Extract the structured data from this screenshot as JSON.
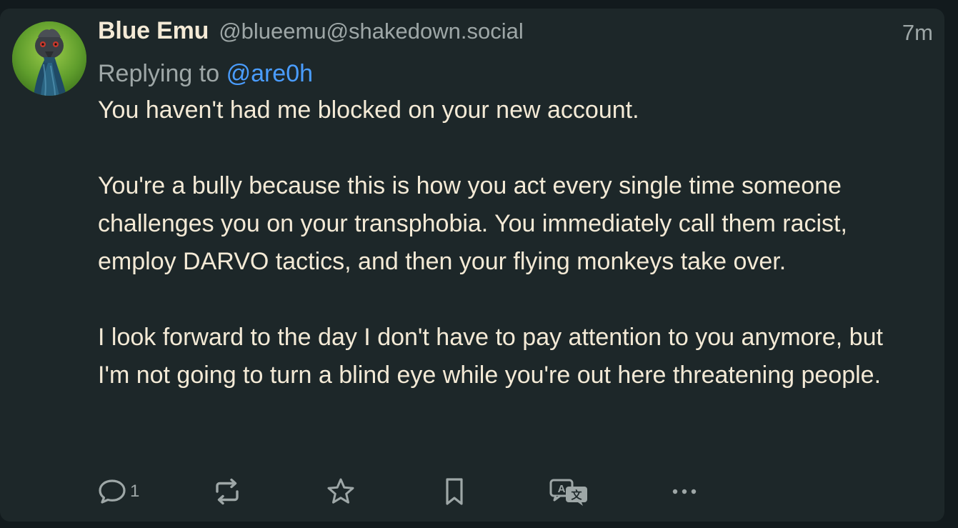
{
  "post": {
    "display_name": "Blue Emu",
    "handle": "@blueemu@shakedown.social",
    "time": "7m",
    "reply_prefix": "Replying to",
    "reply_mention": "@are0h",
    "paragraphs": [
      "You haven't had me blocked on your new account.",
      "You're a bully because this is how you act every single time someone challenges you on your transphobia. You immediately call them racist, employ DARVO tactics, and then your flying monkeys take over.",
      "I look forward to the day I don't have to pay attention to you anymore, but I'm not going to turn a blind eye while you're out here threatening people."
    ]
  },
  "actions": {
    "reply_count": "1",
    "icons": [
      "reply-icon",
      "boost-icon",
      "favourite-icon",
      "bookmark-icon",
      "translate-icon",
      "more-icon"
    ]
  },
  "colors": {
    "background": "#121a1d",
    "card": "#1d2729",
    "text": "#f4ead6",
    "muted": "#9ea7a7",
    "link": "#4a9dff"
  }
}
